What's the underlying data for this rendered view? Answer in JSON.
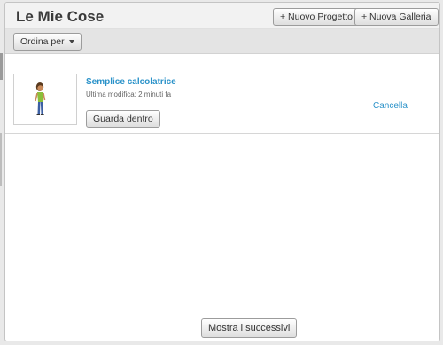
{
  "header": {
    "title": "Le Mie Cose",
    "new_project_label": "+ Nuovo Progetto",
    "new_gallery_label": "+ Nuova Galleria"
  },
  "toolbar": {
    "sort_label": "Ordina per"
  },
  "projects": [
    {
      "title": "Semplice calcolatrice",
      "modified": "Ultima modifica: 2 minuti fa",
      "look_inside_label": "Guarda dentro",
      "delete_label": "Cancella",
      "thumbnail_icon": "sprite-character-icon"
    }
  ],
  "footer": {
    "show_more_label": "Mostra i successivi"
  },
  "colors": {
    "link": "#2a92c9",
    "title": "#3a3a3a"
  }
}
